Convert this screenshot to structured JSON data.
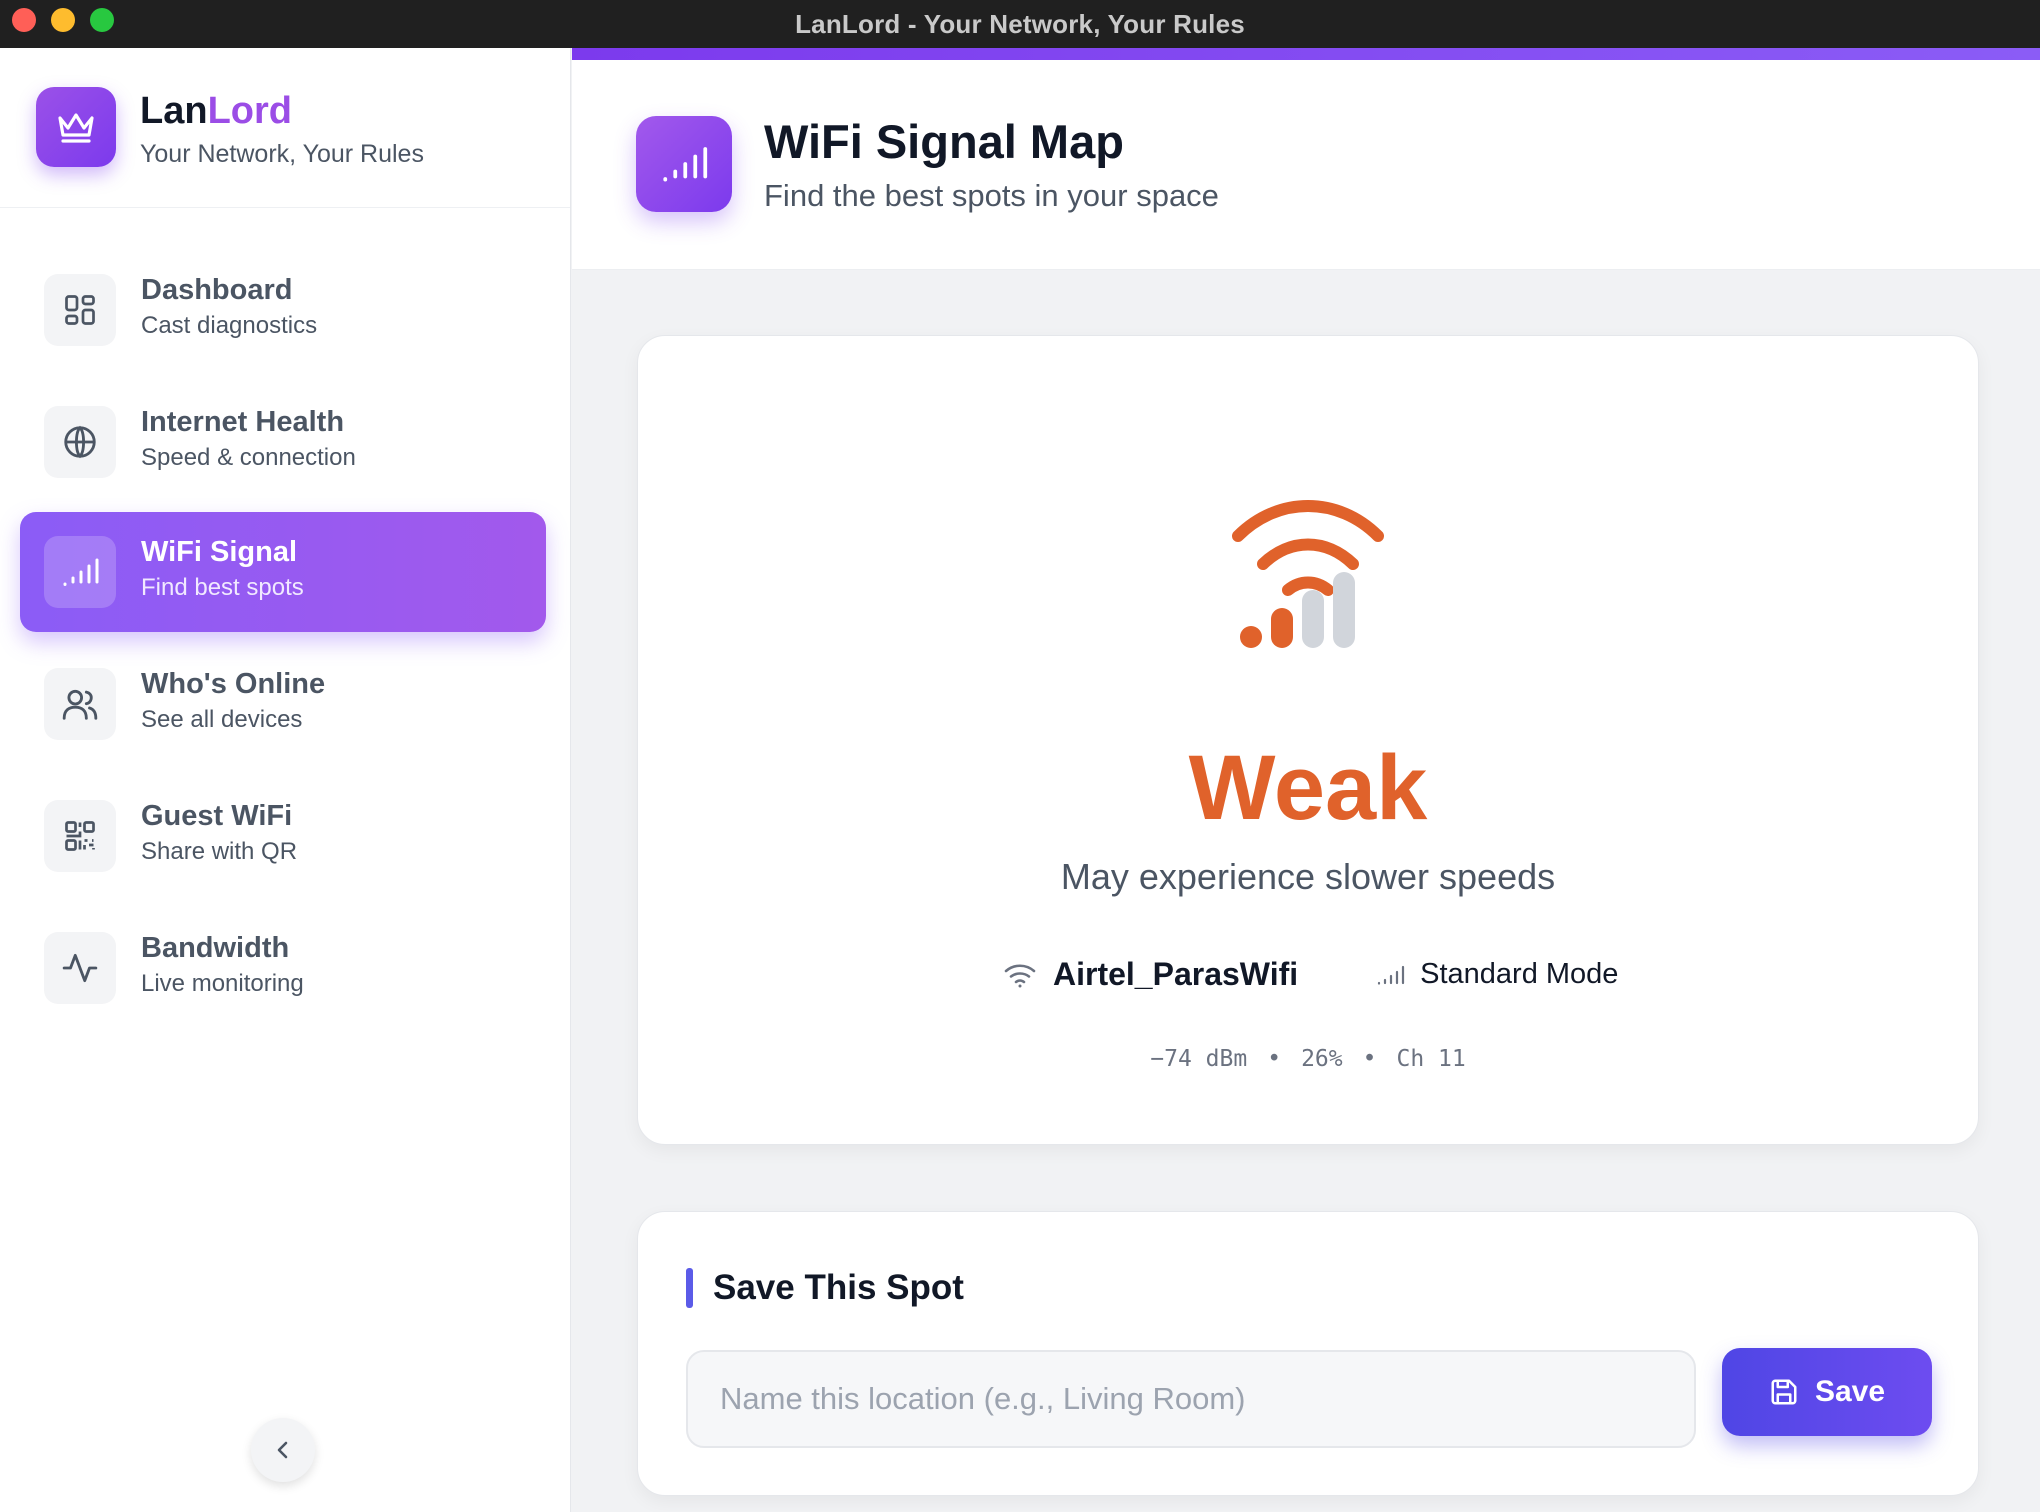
{
  "window": {
    "title": "LanLord - Your Network, Your Rules"
  },
  "brand": {
    "name_part1": "Lan",
    "name_part2": "Lord",
    "tagline": "Your Network, Your Rules"
  },
  "sidebar": {
    "items": [
      {
        "title": "Dashboard",
        "subtitle": "Cast diagnostics",
        "icon": "dashboard-icon",
        "active": false
      },
      {
        "title": "Internet Health",
        "subtitle": "Speed & connection",
        "icon": "globe-icon",
        "active": false
      },
      {
        "title": "WiFi Signal",
        "subtitle": "Find best spots",
        "icon": "signal-bars-icon",
        "active": true
      },
      {
        "title": "Who's Online",
        "subtitle": "See all devices",
        "icon": "users-icon",
        "active": false
      },
      {
        "title": "Guest WiFi",
        "subtitle": "Share with QR",
        "icon": "qr-code-icon",
        "active": false
      },
      {
        "title": "Bandwidth",
        "subtitle": "Live monitoring",
        "icon": "activity-icon",
        "active": false
      }
    ]
  },
  "header": {
    "title": "WiFi Signal Map",
    "subtitle": "Find the best spots in your space"
  },
  "signal": {
    "strength": "Weak",
    "description": "May experience slower speeds",
    "ssid": "Airtel_ParasWifi",
    "mode": "Standard Mode",
    "dbm": "−74 dBm",
    "percent": "26%",
    "channel": "Ch 11",
    "separator": "•",
    "bars_active": 2,
    "bars_total": 4
  },
  "save_spot": {
    "heading": "Save This Spot",
    "placeholder": "Name this location (e.g., Living Room)",
    "button_label": "Save"
  },
  "colors": {
    "accent": "#8b5cf6",
    "weak": "#e0622b",
    "button": "#4f46e5"
  }
}
